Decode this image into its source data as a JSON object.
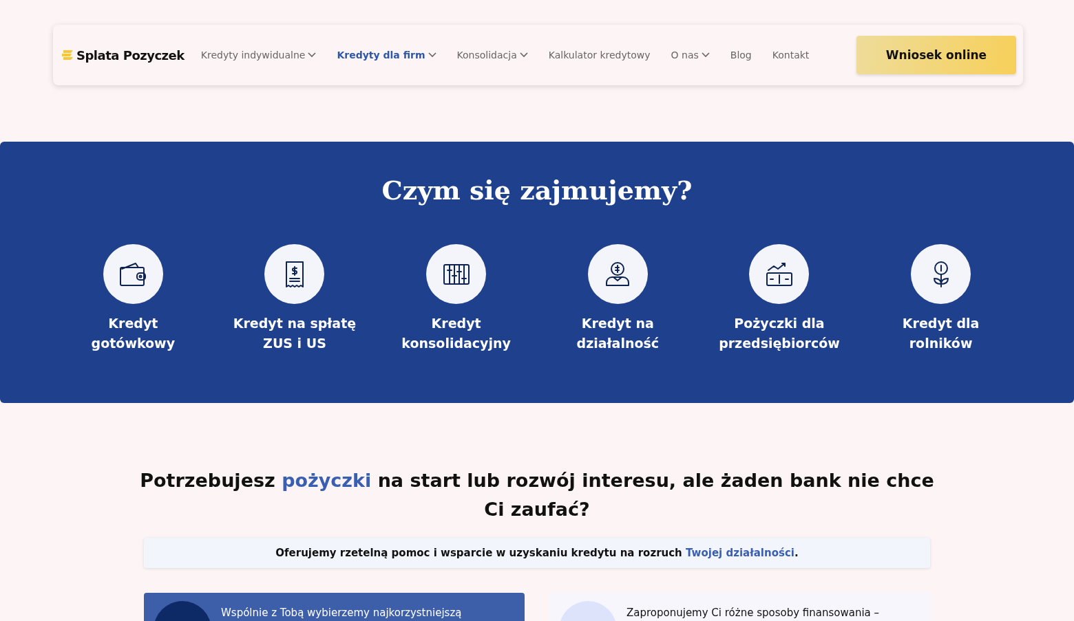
{
  "header": {
    "logo": "Splata Pozyczek",
    "nav": [
      {
        "label": "Kredyty indywidualne",
        "selected": false,
        "dropdown": true
      },
      {
        "label": "Kredyty dla firm",
        "selected": true,
        "dropdown": true
      },
      {
        "label": "Konsolidacja",
        "selected": false,
        "dropdown": true
      },
      {
        "label": "Kalkulator kredytowy",
        "selected": false,
        "dropdown": false
      },
      {
        "label": "O nas",
        "selected": false,
        "dropdown": true
      },
      {
        "label": "Blog",
        "selected": false,
        "dropdown": false
      },
      {
        "label": "Kontakt",
        "selected": false,
        "dropdown": false
      }
    ],
    "cta": "Wniosek online"
  },
  "services": {
    "title": "Czym się zajmujemy?",
    "items": [
      {
        "kind": "wallet",
        "label": "Kredyt gotówkowy"
      },
      {
        "kind": "receipt",
        "label": "Kredyt na spłatę ZUS i US"
      },
      {
        "kind": "abacus",
        "label": "Kredyt konsolidacyjny"
      },
      {
        "kind": "person",
        "label": "Kredyt na działalność"
      },
      {
        "kind": "chart",
        "label": "Pożyczki dla przedsiębiorców"
      },
      {
        "kind": "plant",
        "label": "Kredyt dla rolników"
      }
    ]
  },
  "intro": {
    "heading": [
      {
        "text": "Potrzebujesz ",
        "highlight": false
      },
      {
        "text": "pożyczki",
        "highlight": true
      },
      {
        "text": " na start lub rozwój interesu, ale żaden bank nie chce Ci zaufać?",
        "highlight": false
      }
    ],
    "banner": [
      {
        "text": "Oferujemy rzetelną pomoc i wsparcie w uzyskaniu kredytu na rozruch ",
        "highlight": false
      },
      {
        "text": "Twojej działalności",
        "highlight": true
      },
      {
        "text": ".",
        "highlight": false
      }
    ]
  },
  "cards": [
    {
      "text": "Wspólnie z Tobą wybierzemy najkorzystniejszą",
      "selected": true
    },
    {
      "text": "Zaproponujemy Ci różne sposoby finansowania –",
      "selected": false
    }
  ]
}
